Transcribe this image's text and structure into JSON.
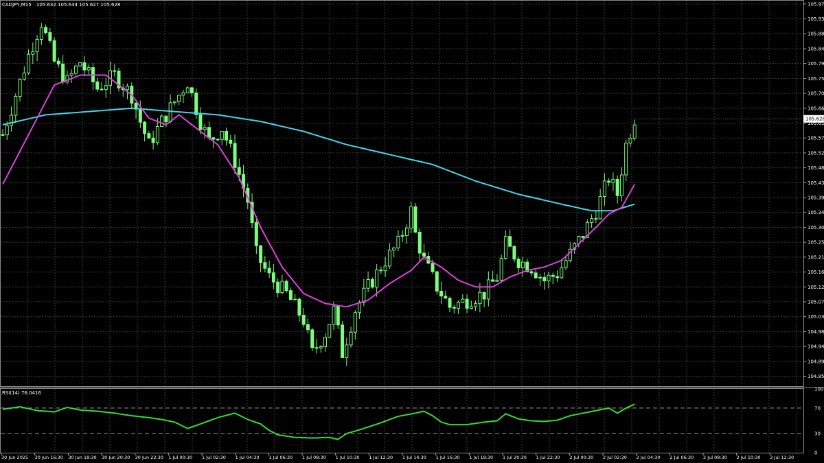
{
  "header": {
    "symbol_info": "CADJPY,M15",
    "ohlc": "105.632 105.634 105.627 105.628"
  },
  "rsi_header": "RSI(14) 76.0416",
  "current_price_tag": "105.628",
  "colors": {
    "background": "#000000",
    "grid": "#3a3a3a",
    "candle": "#7cfc7c",
    "ma_fast": "#e040e0",
    "ma_slow": "#40d8e8",
    "rsi_line": "#33dd33",
    "text": "#ffffff"
  },
  "chart_data": [
    {
      "type": "candlestick",
      "title": "CADJPY,M15",
      "ylim": [
        104.82,
        105.985
      ],
      "yticks": [
        "105.975",
        "105.930",
        "105.885",
        "105.840",
        "105.795",
        "105.750",
        "105.705",
        "105.660",
        "105.615",
        "105.570",
        "105.525",
        "105.480",
        "105.435",
        "105.390",
        "105.345",
        "105.300",
        "105.255",
        "105.210",
        "105.165",
        "105.120",
        "105.075",
        "105.030",
        "104.985",
        "104.940",
        "104.895",
        "104.850"
      ],
      "xticks": [
        "30 Jun 2025",
        "30 Jun 16:30",
        "30 Jun 18:30",
        "30 Jun 20:30",
        "30 Jun 22:30",
        "1 Jul 00:30",
        "1 Jul 02:30",
        "1 Jul 04:30",
        "1 Jul 06:30",
        "1 Jul 08:30",
        "1 Jul 10:30",
        "1 Jul 12:30",
        "1 Jul 14:30",
        "1 Jul 16:30",
        "1 Jul 18:30",
        "1 Jul 20:30",
        "1 Jul 22:30",
        "2 Jul 00:30",
        "2 Jul 02:30",
        "2 Jul 04:30",
        "2 Jul 06:30",
        "2 Jul 08:30",
        "2 Jul 10:30",
        "2 Jul 12:30"
      ],
      "close_path": [
        [
          0,
          105.58
        ],
        [
          3,
          105.7
        ],
        [
          6,
          105.82
        ],
        [
          9,
          105.92
        ],
        [
          12,
          105.8
        ],
        [
          15,
          105.74
        ],
        [
          18,
          105.8
        ],
        [
          22,
          105.72
        ],
        [
          26,
          105.76
        ],
        [
          30,
          105.7
        ],
        [
          32,
          105.62
        ],
        [
          34,
          105.55
        ],
        [
          37,
          105.62
        ],
        [
          40,
          105.68
        ],
        [
          43,
          105.74
        ],
        [
          46,
          105.62
        ],
        [
          48,
          105.56
        ],
        [
          51,
          105.6
        ],
        [
          54,
          105.5
        ],
        [
          57,
          105.38
        ],
        [
          59,
          105.22
        ],
        [
          62,
          105.15
        ],
        [
          66,
          105.1
        ],
        [
          70,
          105.02
        ],
        [
          72,
          104.92
        ],
        [
          75,
          104.98
        ],
        [
          77,
          105.05
        ],
        [
          79,
          104.92
        ],
        [
          82,
          105.05
        ],
        [
          85,
          105.12
        ],
        [
          89,
          105.2
        ],
        [
          92,
          105.25
        ],
        [
          95,
          105.35
        ],
        [
          96,
          105.28
        ],
        [
          98,
          105.2
        ],
        [
          101,
          105.12
        ],
        [
          104,
          105.06
        ],
        [
          108,
          105.08
        ],
        [
          112,
          105.1
        ],
        [
          115,
          105.15
        ],
        [
          117,
          105.25
        ],
        [
          120,
          105.2
        ],
        [
          123,
          105.18
        ],
        [
          126,
          105.14
        ],
        [
          129,
          105.16
        ],
        [
          132,
          105.22
        ],
        [
          135,
          105.28
        ],
        [
          138,
          105.35
        ],
        [
          141,
          105.45
        ],
        [
          143,
          105.4
        ],
        [
          145,
          105.55
        ],
        [
          147,
          105.63
        ]
      ],
      "ma_fast": {
        "color": "#e040e0",
        "points": [
          [
            0,
            105.43
          ],
          [
            6,
            105.58
          ],
          [
            12,
            105.73
          ],
          [
            18,
            105.76
          ],
          [
            24,
            105.76
          ],
          [
            30,
            105.7
          ],
          [
            34,
            105.63
          ],
          [
            38,
            105.61
          ],
          [
            41,
            105.64
          ],
          [
            45,
            105.6
          ],
          [
            50,
            105.55
          ],
          [
            55,
            105.45
          ],
          [
            60,
            105.3
          ],
          [
            65,
            105.18
          ],
          [
            70,
            105.1
          ],
          [
            75,
            105.07
          ],
          [
            80,
            105.06
          ],
          [
            85,
            105.08
          ],
          [
            90,
            105.13
          ],
          [
            95,
            105.17
          ],
          [
            98,
            105.21
          ],
          [
            102,
            105.18
          ],
          [
            106,
            105.14
          ],
          [
            110,
            105.12
          ],
          [
            114,
            105.12
          ],
          [
            118,
            105.15
          ],
          [
            122,
            105.17
          ],
          [
            126,
            105.18
          ],
          [
            130,
            105.2
          ],
          [
            134,
            105.25
          ],
          [
            138,
            105.3
          ],
          [
            141,
            105.34
          ],
          [
            144,
            105.36
          ],
          [
            147,
            105.43
          ]
        ]
      },
      "ma_slow": {
        "color": "#40d8e8",
        "points": [
          [
            0,
            105.61
          ],
          [
            10,
            105.64
          ],
          [
            20,
            105.65
          ],
          [
            30,
            105.66
          ],
          [
            40,
            105.65
          ],
          [
            50,
            105.64
          ],
          [
            60,
            105.62
          ],
          [
            70,
            105.59
          ],
          [
            80,
            105.55
          ],
          [
            90,
            105.52
          ],
          [
            100,
            105.49
          ],
          [
            110,
            105.44
          ],
          [
            120,
            105.4
          ],
          [
            130,
            105.37
          ],
          [
            137,
            105.35
          ],
          [
            142,
            105.35
          ],
          [
            147,
            105.37
          ]
        ]
      },
      "n_bars": 148,
      "last_price": 105.628
    },
    {
      "type": "line",
      "title": "RSI(14) 76.0416",
      "ylim": [
        0,
        100
      ],
      "yticks": [
        "100",
        "70",
        "30",
        "0"
      ],
      "levels": [
        70,
        30
      ],
      "series": [
        {
          "color": "#33dd33",
          "points": [
            [
              0,
              68
            ],
            [
              4,
              72
            ],
            [
              8,
              66
            ],
            [
              12,
              64
            ],
            [
              15,
              71
            ],
            [
              18,
              67
            ],
            [
              22,
              65
            ],
            [
              26,
              62
            ],
            [
              30,
              58
            ],
            [
              34,
              55
            ],
            [
              37,
              52
            ],
            [
              40,
              48
            ],
            [
              43,
              38
            ],
            [
              46,
              45
            ],
            [
              50,
              55
            ],
            [
              54,
              62
            ],
            [
              57,
              52
            ],
            [
              60,
              45
            ],
            [
              62,
              35
            ],
            [
              64,
              28
            ],
            [
              68,
              24
            ],
            [
              72,
              23
            ],
            [
              76,
              24
            ],
            [
              78,
              21
            ],
            [
              80,
              30
            ],
            [
              84,
              38
            ],
            [
              88,
              47
            ],
            [
              92,
              57
            ],
            [
              96,
              62
            ],
            [
              98,
              65
            ],
            [
              100,
              58
            ],
            [
              102,
              48
            ],
            [
              104,
              44
            ],
            [
              108,
              44
            ],
            [
              112,
              48
            ],
            [
              115,
              50
            ],
            [
              117,
              61
            ],
            [
              120,
              53
            ],
            [
              123,
              50
            ],
            [
              126,
              49
            ],
            [
              129,
              51
            ],
            [
              132,
              58
            ],
            [
              135,
              62
            ],
            [
              138,
              66
            ],
            [
              141,
              70
            ],
            [
              143,
              62
            ],
            [
              145,
              70
            ],
            [
              147,
              76
            ]
          ]
        }
      ]
    }
  ]
}
